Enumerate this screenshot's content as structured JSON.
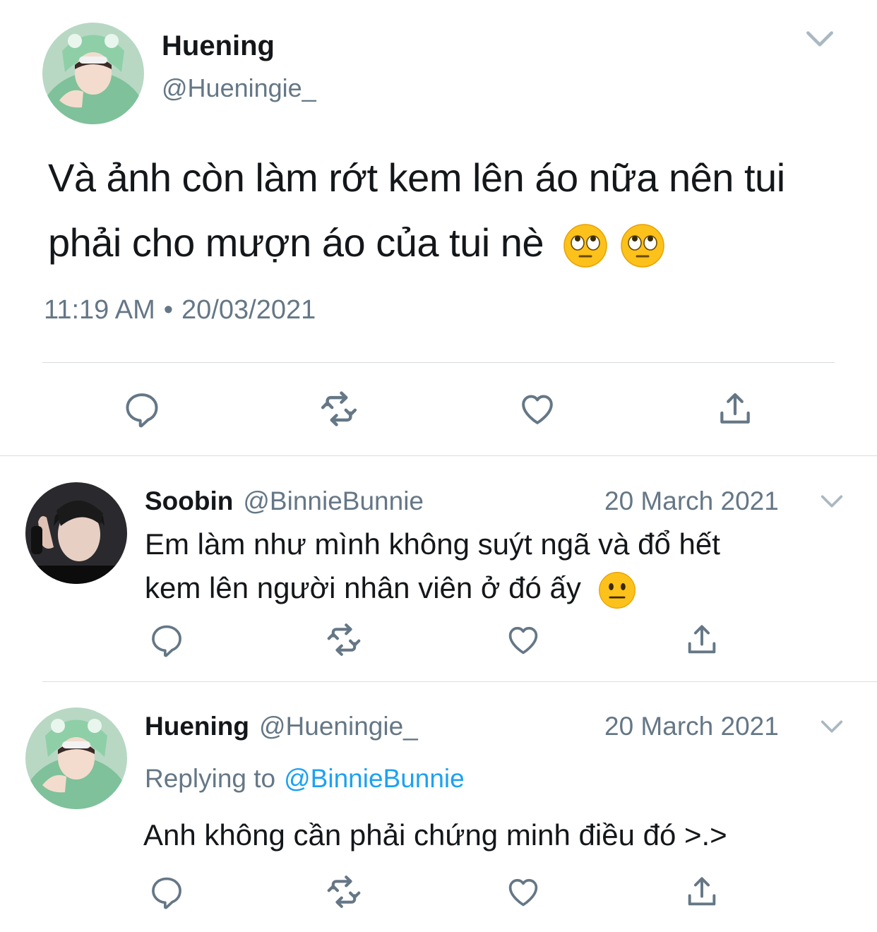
{
  "main_tweet": {
    "display_name": "Huening",
    "handle": "@Hueningie_",
    "text_line1": "Và ảnh còn làm rớt kem lên áo nữa nên tui",
    "text_line2": "phải cho mượn áo của tui nè",
    "emojis": [
      "face-with-rolling-eyes",
      "face-with-rolling-eyes"
    ],
    "time": "11:19 AM",
    "separator": "•",
    "date": "20/03/2021"
  },
  "reply1": {
    "display_name": "Soobin",
    "handle": "@BinnieBunnie",
    "date": "20 March 2021",
    "text_line1": "Em làm như mình không suýt ngã và đổ hết",
    "text_line2": "kem lên người nhân viên ở đó ấy",
    "emoji": "neutral-face"
  },
  "reply2": {
    "display_name": "Huening",
    "handle": "@Hueningie_",
    "date": "20 March 2021",
    "replying_label": "Replying to",
    "replying_to": "@BinnieBunnie",
    "text": "Anh không cần phải chứng minh điều đó >.>"
  },
  "icons": {
    "reply": "speech-bubble-icon",
    "retweet": "retweet-arrows-icon",
    "like": "heart-icon",
    "share": "share-upload-icon",
    "menu": "chevron-down-icon"
  },
  "colors": {
    "text": "#14171a",
    "muted": "#657786",
    "link": "#1da1f2",
    "divider": "#d9dde1",
    "icon": "#657786"
  }
}
